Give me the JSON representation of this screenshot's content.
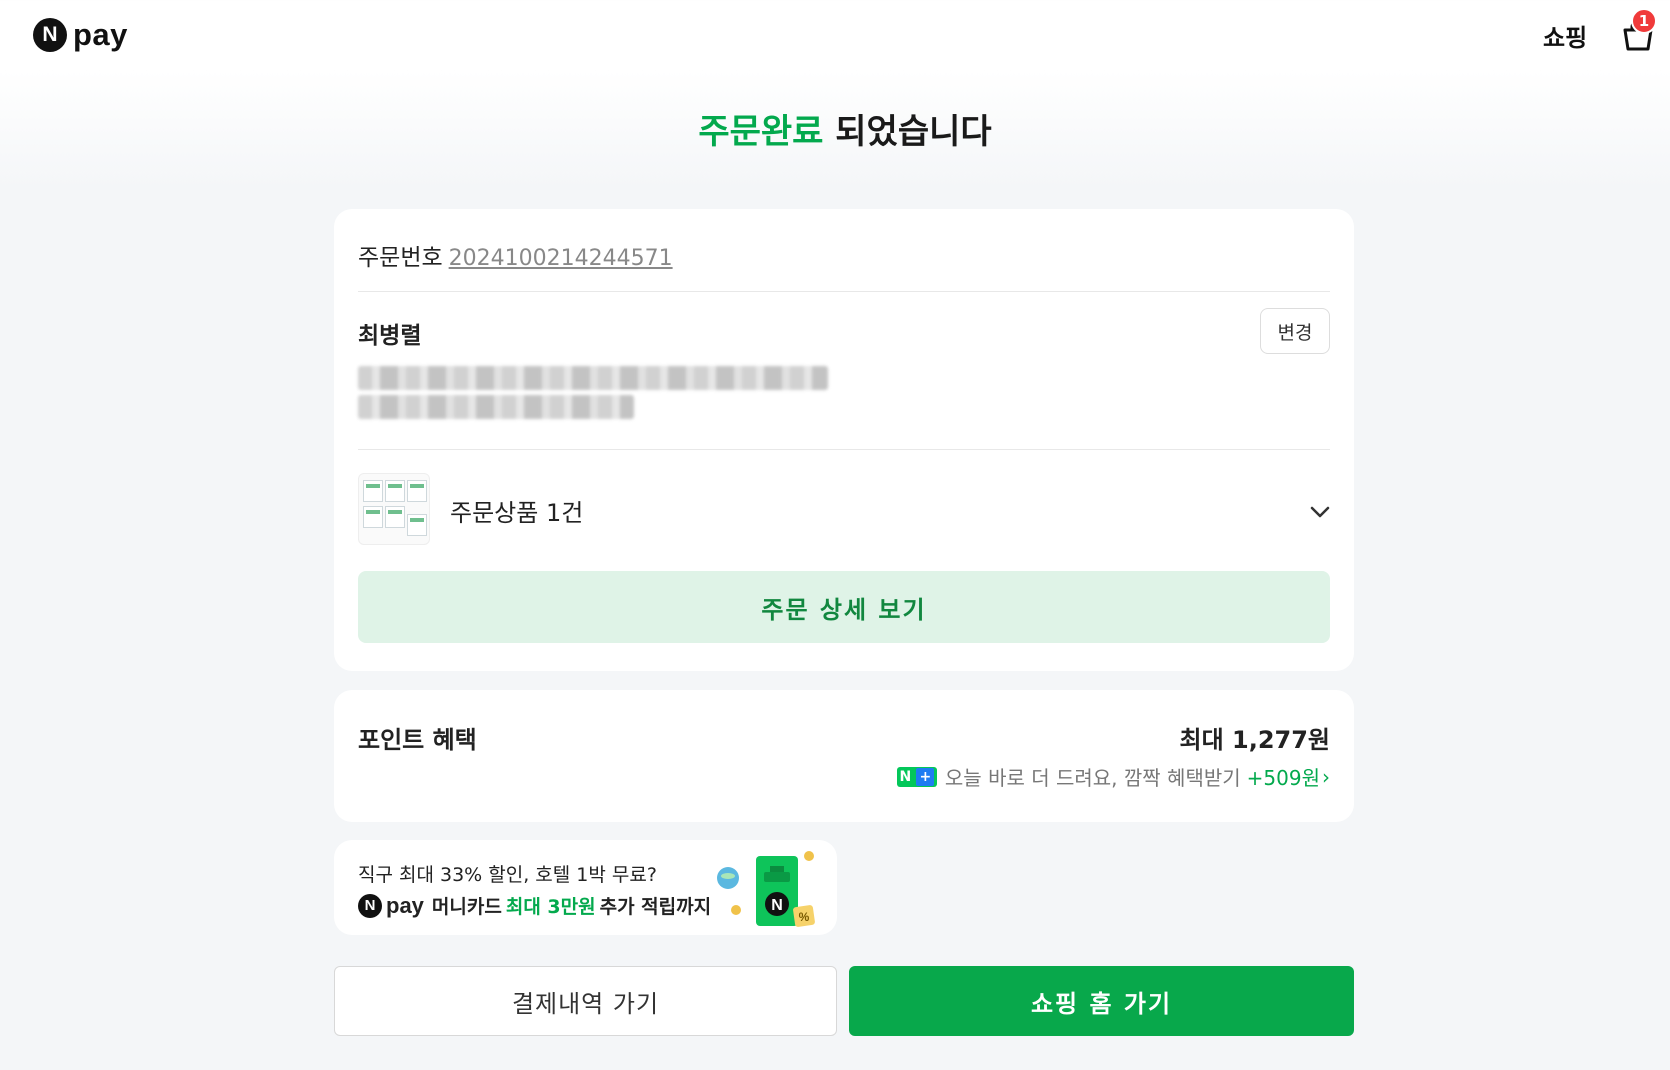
{
  "header": {
    "logo_text": "pay",
    "logo_letter": "N",
    "shop_link": "쇼핑",
    "cart_count": "1"
  },
  "title": {
    "accent": "주문완료",
    "rest": " 되었습니다"
  },
  "order": {
    "number_label": "주문번호",
    "number_value": "2024100214244571",
    "recipient_name": "최병렬",
    "change_label": "변경",
    "product_summary": "주문상품 1건",
    "detail_button": "주문 상세 보기"
  },
  "points": {
    "title": "포인트 혜택",
    "max_amount": "최대 1,277원",
    "badge": "N+",
    "sub_text": "오늘 바로 더 드려요, 깜짝 혜택받기",
    "extra": "+509원",
    "extra_arrow": "›"
  },
  "ad": {
    "line1": "직구 최대 33% 할인, 호텔 1박 무료?",
    "logo_letter": "N",
    "logo_text": "pay",
    "line2_pre": "머니카드",
    "line2_accent": "최대 3만원",
    "line2_post": "추가 적립까지"
  },
  "buttons": {
    "history": "결제내역 가기",
    "home": "쇼핑 홈 가기"
  },
  "colors": {
    "accent": "#03a94d",
    "primary_button": "#08a84b",
    "detail_button_bg": "#dff3e7",
    "badge": "#f03a3a"
  }
}
